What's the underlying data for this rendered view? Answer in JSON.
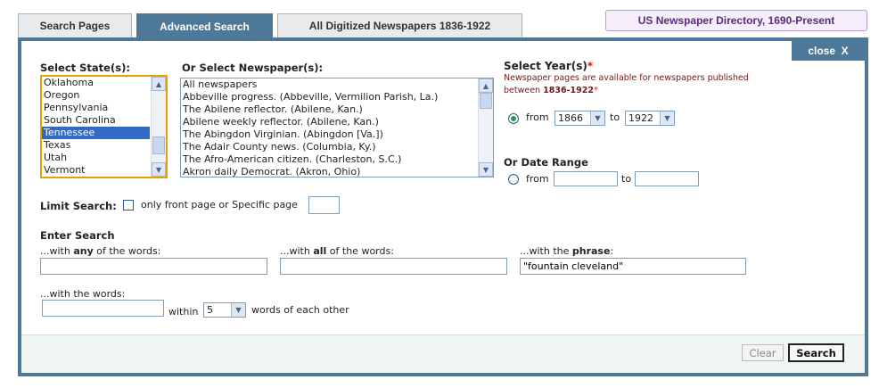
{
  "tabs": [
    {
      "label": "Search Pages",
      "active": false
    },
    {
      "label": "Advanced Search",
      "active": true
    },
    {
      "label": "All Digitized Newspapers 1836-1922",
      "active": false
    }
  ],
  "directory_label": "US Newspaper Directory, 1690-Present",
  "close_label": "close",
  "close_glyph": "X",
  "state": {
    "label": "Select State(s):",
    "options": [
      "Oklahoma",
      "Oregon",
      "Pennsylvania",
      "South Carolina",
      "Tennessee",
      "Texas",
      "Utah",
      "Vermont"
    ],
    "selected": "Tennessee"
  },
  "newspapers": {
    "label": "Or Select Newspaper(s):",
    "options": [
      "All newspapers",
      "Abbeville progress. (Abbeville, Vermilion Parish, La.)",
      "The Abilene reflector. (Abilene, Kan.)",
      "Abilene weekly reflector. (Abilene, Kan.)",
      "The Abingdon Virginian. (Abingdon [Va.])",
      "The Adair County news. (Columbia, Ky.)",
      "The Afro-American citizen. (Charleston, S.C.)",
      "Akron daily Democrat. (Akron, Ohio)"
    ]
  },
  "year": {
    "label": "Select Year(s)",
    "required_mark": "*",
    "note_line1": "Newspaper pages are available for newspapers published",
    "note_line2_prefix": "between ",
    "note_range": "1836-1922",
    "from_label": "from",
    "to_label": "to",
    "from_value": "1866",
    "to_value": "1922"
  },
  "date_range": {
    "label": "Or Date Range",
    "from_label": "from",
    "to_label": "to",
    "from_value": "",
    "to_value": ""
  },
  "limit": {
    "label": "Limit Search:",
    "text": "only front page or Specific page",
    "page_value": ""
  },
  "enter_search": {
    "label": "Enter Search",
    "any_prefix": "...with ",
    "any_bold": "any",
    "any_suffix": " of the words:",
    "all_prefix": "...with ",
    "all_bold": "all",
    "all_suffix": " of the words:",
    "phrase_prefix": "...with the ",
    "phrase_bold": "phrase",
    "phrase_suffix": ":",
    "any_value": "",
    "all_value": "",
    "phrase_value": "\"fountain cleveland\"",
    "words_label": "...with the words:",
    "words_value": "",
    "within_label": "within",
    "within_value": "5",
    "proximity_suffix": "words of each other"
  },
  "buttons": {
    "clear": "Clear",
    "search": "Search"
  },
  "colors": {
    "accent": "#4e7898",
    "required": "#c4161c",
    "selected": "#3169c6"
  }
}
